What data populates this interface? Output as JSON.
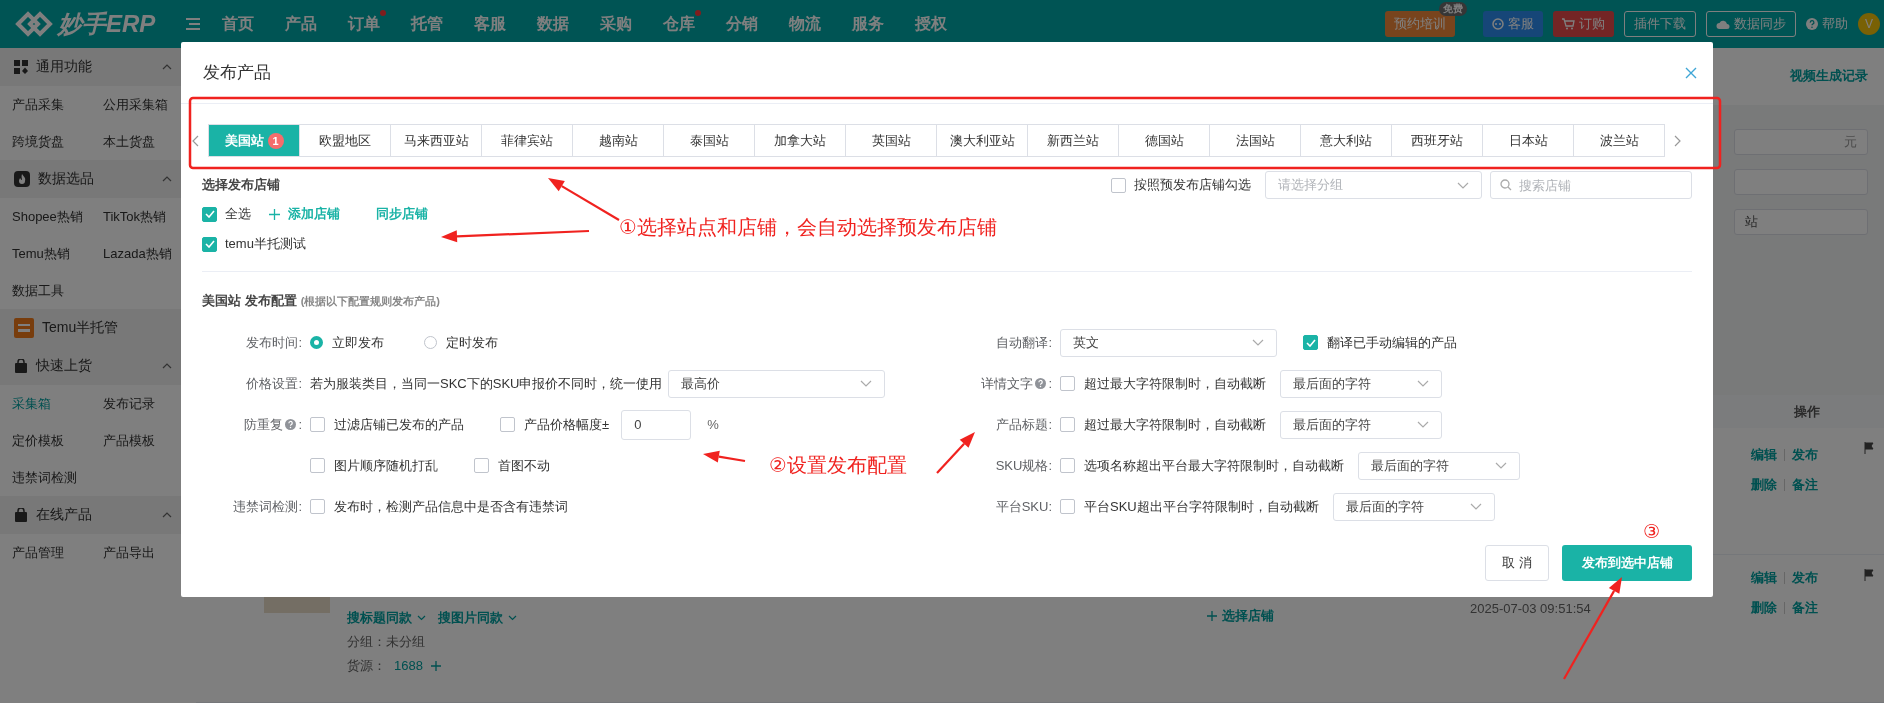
{
  "top_bar": {
    "logo": "妙手ERP",
    "nav": [
      {
        "label": "首页",
        "dot": false
      },
      {
        "label": "产品",
        "dot": false
      },
      {
        "label": "订单",
        "dot": true
      },
      {
        "label": "托管",
        "dot": false
      },
      {
        "label": "客服",
        "dot": false
      },
      {
        "label": "数据",
        "dot": false
      },
      {
        "label": "采购",
        "dot": false
      },
      {
        "label": "仓库",
        "dot": true
      },
      {
        "label": "分销",
        "dot": false
      },
      {
        "label": "物流",
        "dot": false
      },
      {
        "label": "服务",
        "dot": false
      },
      {
        "label": "授权",
        "dot": false
      }
    ],
    "actions": [
      {
        "kind": "promo",
        "label": "预约培训",
        "badge": "免费"
      },
      {
        "kind": "service",
        "label": "客服"
      },
      {
        "kind": "order",
        "label": "订购"
      },
      {
        "kind": "plugin",
        "label": "插件下载"
      },
      {
        "kind": "sync",
        "label": "数据同步"
      },
      {
        "kind": "help",
        "label": "帮助"
      }
    ],
    "avatar": "V"
  },
  "sidebar": {
    "sections": [
      {
        "kind": "group",
        "title": "通用功能",
        "expanded": true,
        "items": [
          {
            "label": "产品采集",
            "selected": false
          },
          {
            "label": "公用采集箱",
            "selected": false
          },
          {
            "label": "跨境货盘",
            "selected": false
          },
          {
            "label": "本土货盘",
            "selected": false
          }
        ]
      },
      {
        "kind": "group",
        "title": "数据选品",
        "expanded": true,
        "items": [
          {
            "label": "Shopee热销",
            "selected": false
          },
          {
            "label": "TikTok热销",
            "selected": false
          },
          {
            "label": "Temu热销",
            "selected": false
          },
          {
            "label": "Lazada热销",
            "selected": false
          },
          {
            "label": "数据工具",
            "selected": false
          }
        ]
      },
      {
        "kind": "link",
        "title": "Temu半托管"
      },
      {
        "kind": "group",
        "title": "快速上货",
        "expanded": true,
        "items": [
          {
            "label": "采集箱",
            "selected": true
          },
          {
            "label": "发布记录",
            "selected": false
          },
          {
            "label": "定价模板",
            "selected": false
          },
          {
            "label": "产品模板",
            "selected": false
          },
          {
            "label": "违禁词检测",
            "selected": false
          }
        ]
      },
      {
        "kind": "group",
        "title": "在线产品",
        "expanded": true,
        "items": [
          {
            "label": "产品管理",
            "selected": false
          },
          {
            "label": "产品导出",
            "selected": false
          }
        ]
      }
    ]
  },
  "main": {
    "header_link": "视频生成记录",
    "filter_fields": [
      {
        "kind": "suffix",
        "text": "元"
      },
      {
        "kind": "blank"
      },
      {
        "kind": "value",
        "text": "站"
      }
    ],
    "table": {
      "columns": [
        {
          "label": "操作"
        }
      ],
      "rows": [
        {
          "actions": [
            "编辑",
            "发布",
            "删除",
            "备注"
          ]
        },
        {
          "product": {
            "links": [
              "搜标题同款",
              "搜图片同款"
            ],
            "group": "分组：未分组",
            "source_label": "货源：",
            "source": "1688"
          },
          "store_action": "选择店铺",
          "time": "2025-07-03 09:51:54",
          "actions": [
            "编辑",
            "发布",
            "删除",
            "备注"
          ]
        }
      ]
    }
  },
  "modal": {
    "title": "发布产品",
    "site_tabs": [
      {
        "label": "美国站",
        "selected": true,
        "badge": "1"
      },
      {
        "label": "欧盟地区",
        "selected": false
      },
      {
        "label": "马来西亚站",
        "selected": false
      },
      {
        "label": "菲律宾站",
        "selected": false
      },
      {
        "label": "越南站",
        "selected": false
      },
      {
        "label": "泰国站",
        "selected": false
      },
      {
        "label": "加拿大站",
        "selected": false
      },
      {
        "label": "英国站",
        "selected": false
      },
      {
        "label": "澳大利亚站",
        "selected": false
      },
      {
        "label": "新西兰站",
        "selected": false
      },
      {
        "label": "德国站",
        "selected": false
      },
      {
        "label": "法国站",
        "selected": false
      },
      {
        "label": "意大利站",
        "selected": false
      },
      {
        "label": "西班牙站",
        "selected": false
      },
      {
        "label": "日本站",
        "selected": false
      },
      {
        "label": "波兰站",
        "selected": false
      }
    ],
    "store_select": {
      "heading": "选择发布店铺",
      "preset": {
        "label": "按照预发布店铺勾选",
        "checked": false
      },
      "group_select": {
        "placeholder": "请选择分组"
      },
      "search": {
        "placeholder": "搜索店铺"
      },
      "select_all": {
        "label": "全选",
        "checked": true
      },
      "add_link": "添加店铺",
      "sync_link": "同步店铺",
      "stores": [
        {
          "label": "temu半托测试",
          "checked": true
        }
      ]
    },
    "config": {
      "site": "美国站",
      "title": "发布配置",
      "note": "(根据以下配置规则发布产品)",
      "left": [
        {
          "label": "发布时间:",
          "controls": [
            {
              "kind": "radio",
              "label": "立即发布",
              "selected": true
            },
            {
              "kind": "radio",
              "label": "定时发布",
              "selected": false
            }
          ]
        },
        {
          "label": "价格设置:",
          "controls": [
            {
              "kind": "text",
              "label": "若为服装类目，当同一SKC下的SKU申报价不同时，统一使用"
            },
            {
              "kind": "select",
              "value": "最高价"
            }
          ]
        },
        {
          "label": "防重复",
          "help": true,
          "label_end": ":",
          "controls": [
            {
              "kind": "checkbox",
              "label": "过滤店铺已发布的产品",
              "checked": false
            },
            {
              "kind": "checkbox",
              "label": "产品价格幅度±",
              "checked": false
            },
            {
              "kind": "input",
              "value": "0",
              "unit": "%"
            }
          ]
        },
        {
          "controls": [
            {
              "kind": "checkbox",
              "label": "图片顺序随机打乱",
              "checked": false
            },
            {
              "kind": "checkbox",
              "label": "首图不动",
              "checked": false
            }
          ]
        },
        {
          "label": "违禁词检测:",
          "controls": [
            {
              "kind": "checkbox",
              "label": "发布时，检测产品信息中是否含有违禁词",
              "checked": false
            }
          ]
        }
      ],
      "right": [
        {
          "label": "自动翻译:",
          "controls": [
            {
              "kind": "select",
              "value": "英文"
            },
            {
              "kind": "checkbox",
              "label": "翻译已手动编辑的产品",
              "checked": true
            }
          ]
        },
        {
          "label": "详情文字",
          "help": true,
          "label_end": ":",
          "controls": [
            {
              "kind": "checkbox",
              "label": "超过最大字符限制时，自动截断",
              "checked": false
            },
            {
              "kind": "select",
              "value": "最后面的字符"
            }
          ]
        },
        {
          "label": "产品标题:",
          "controls": [
            {
              "kind": "checkbox",
              "label": "超过最大字符限制时，自动截断",
              "checked": false
            },
            {
              "kind": "select",
              "value": "最后面的字符"
            }
          ]
        },
        {
          "label": "SKU规格:",
          "controls": [
            {
              "kind": "checkbox",
              "label": "选项名称超出平台最大字符限制时，自动截断",
              "checked": false
            },
            {
              "kind": "select",
              "value": "最后面的字符"
            }
          ]
        },
        {
          "label": "平台SKU:",
          "controls": [
            {
              "kind": "checkbox",
              "label": "平台SKU超出平台字符限制时，自动截断",
              "checked": false
            },
            {
              "kind": "select",
              "value": "最后面的字符"
            }
          ]
        }
      ]
    },
    "buttons": [
      {
        "kind": "secondary",
        "label": "取 消"
      },
      {
        "kind": "primary",
        "label": "发布到选中店铺"
      }
    ]
  },
  "annotations": [
    {
      "text": "①选择站点和店铺，会自动选择预发布店铺"
    },
    {
      "text": "②设置发布配置"
    },
    {
      "text": "③"
    }
  ]
}
